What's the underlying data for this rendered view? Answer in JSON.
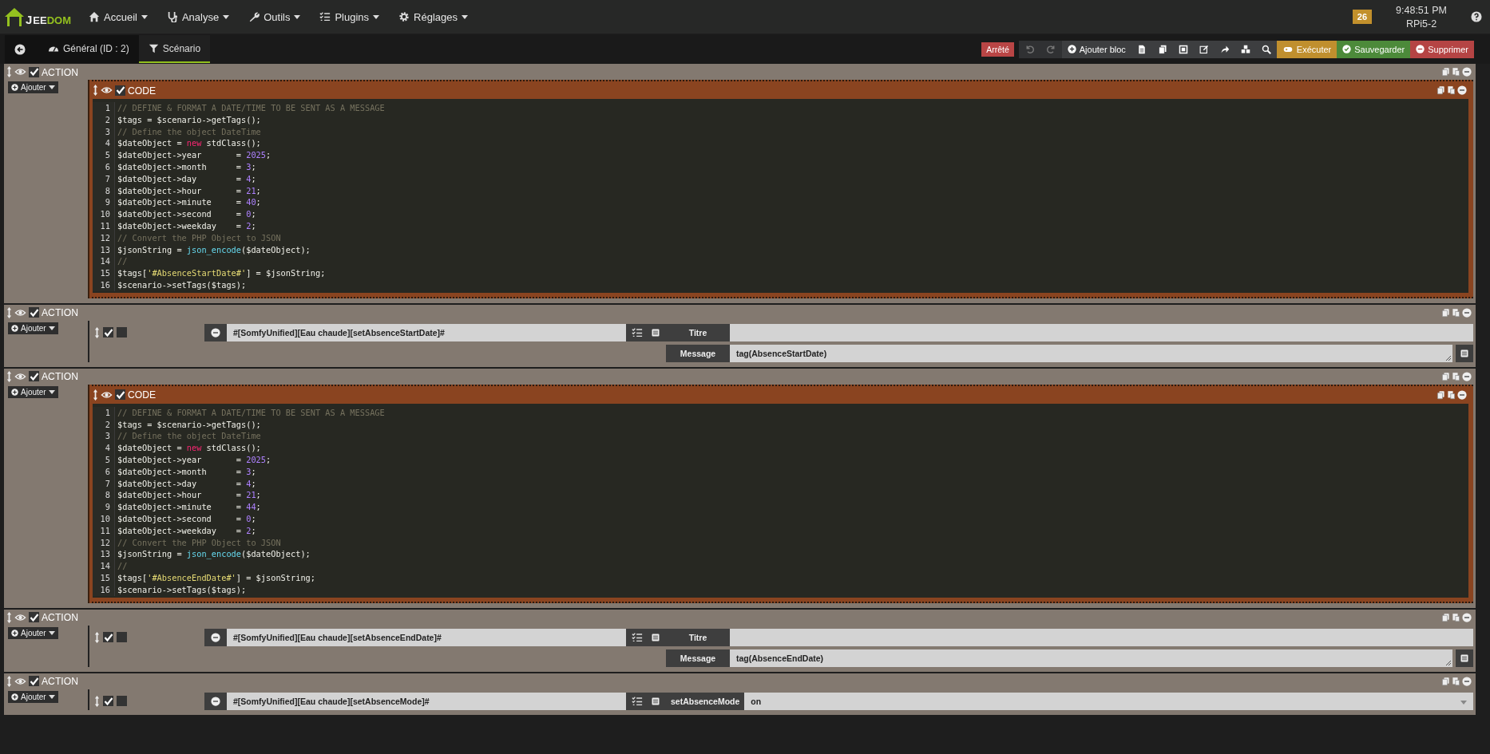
{
  "nav": {
    "logo": {
      "initial": "J",
      "middle": "EE",
      "end": "DOM"
    },
    "menu": [
      {
        "label": "Accueil"
      },
      {
        "label": "Analyse"
      },
      {
        "label": "Outils"
      },
      {
        "label": "Plugins"
      },
      {
        "label": "Réglages"
      }
    ],
    "badge": "26",
    "clock": "9:48:51 PM",
    "host": "RPi5-2"
  },
  "tabs": [
    {
      "label": "Général (ID : 2)",
      "selected": false
    },
    {
      "label": "Scénario",
      "selected": true
    }
  ],
  "toolbar": {
    "state": "Arrêté",
    "add_block": "Ajouter bloc",
    "run": "Exécuter",
    "save": "Sauvegarder",
    "delete": "Supprimer"
  },
  "blocks": [
    {
      "title": "ACTION",
      "enabled": true,
      "add_button": "Ajouter",
      "element": {
        "kind": "code",
        "title": "CODE",
        "enabled": true,
        "lines": [
          {
            "n": "1",
            "tokens": [
              {
                "kind": "comment",
                "text": "// DEFINE & FORMAT A DATE/TIME TO BE SENT AS A MESSAGE"
              }
            ]
          },
          {
            "n": "2",
            "tokens": [
              {
                "kind": "plain",
                "text": "$tags = $scenario->getTags();"
              }
            ]
          },
          {
            "n": "3",
            "tokens": [
              {
                "kind": "comment",
                "text": "// Define the object DateTime"
              }
            ]
          },
          {
            "n": "4",
            "tokens": [
              {
                "kind": "plain",
                "text": "$dateObject = "
              },
              {
                "kind": "keyword",
                "text": "new"
              },
              {
                "kind": "plain",
                "text": " stdClass();"
              }
            ]
          },
          {
            "n": "5",
            "tokens": [
              {
                "kind": "plain",
                "text": "$dateObject->year       = "
              },
              {
                "kind": "number",
                "text": "2025"
              },
              {
                "kind": "plain",
                "text": ";"
              }
            ]
          },
          {
            "n": "6",
            "tokens": [
              {
                "kind": "plain",
                "text": "$dateObject->month      = "
              },
              {
                "kind": "number",
                "text": "3"
              },
              {
                "kind": "plain",
                "text": ";"
              }
            ]
          },
          {
            "n": "7",
            "tokens": [
              {
                "kind": "plain",
                "text": "$dateObject->day        = "
              },
              {
                "kind": "number",
                "text": "4"
              },
              {
                "kind": "plain",
                "text": ";"
              }
            ]
          },
          {
            "n": "8",
            "tokens": [
              {
                "kind": "plain",
                "text": "$dateObject->hour       = "
              },
              {
                "kind": "number",
                "text": "21"
              },
              {
                "kind": "plain",
                "text": ";"
              }
            ]
          },
          {
            "n": "9",
            "tokens": [
              {
                "kind": "plain",
                "text": "$dateObject->minute     = "
              },
              {
                "kind": "number",
                "text": "40"
              },
              {
                "kind": "plain",
                "text": ";"
              }
            ]
          },
          {
            "n": "10",
            "tokens": [
              {
                "kind": "plain",
                "text": "$dateObject->second     = "
              },
              {
                "kind": "number",
                "text": "0"
              },
              {
                "kind": "plain",
                "text": ";"
              }
            ]
          },
          {
            "n": "11",
            "tokens": [
              {
                "kind": "plain",
                "text": "$dateObject->weekday    = "
              },
              {
                "kind": "number",
                "text": "2"
              },
              {
                "kind": "plain",
                "text": ";"
              }
            ]
          },
          {
            "n": "12",
            "tokens": [
              {
                "kind": "comment",
                "text": "// Convert the PHP Object to JSON"
              }
            ]
          },
          {
            "n": "13",
            "tokens": [
              {
                "kind": "plain",
                "text": "$jsonString = "
              },
              {
                "kind": "builtin",
                "text": "json_encode"
              },
              {
                "kind": "plain",
                "text": "($dateObject);"
              }
            ]
          },
          {
            "n": "14",
            "tokens": [
              {
                "kind": "comment",
                "text": "//"
              }
            ]
          },
          {
            "n": "15",
            "tokens": [
              {
                "kind": "plain",
                "text": "$tags["
              },
              {
                "kind": "string",
                "text": "'#AbsenceStartDate#'"
              },
              {
                "kind": "plain",
                "text": "] = $jsonString;"
              }
            ]
          },
          {
            "n": "16",
            "tokens": [
              {
                "kind": "plain",
                "text": "$scenario->setTags($tags);"
              }
            ]
          }
        ]
      }
    },
    {
      "title": "ACTION",
      "enabled": true,
      "add_button": "Ajouter",
      "element": {
        "kind": "action",
        "enabled": true,
        "background": false,
        "command": "#[SomfyUnified][Eau chaude][setAbsenceStartDate]#",
        "options": [
          {
            "kind": "text",
            "label": "Titre"
          },
          {
            "kind": "textarea",
            "label": "Message",
            "value": "tag(AbsenceStartDate)"
          }
        ]
      }
    },
    {
      "title": "ACTION",
      "enabled": true,
      "add_button": "Ajouter",
      "element": {
        "kind": "code",
        "title": "CODE",
        "enabled": true,
        "lines": [
          {
            "n": "1",
            "tokens": [
              {
                "kind": "comment",
                "text": "// DEFINE & FORMAT A DATE/TIME TO BE SENT AS A MESSAGE"
              }
            ]
          },
          {
            "n": "2",
            "tokens": [
              {
                "kind": "plain",
                "text": "$tags = $scenario->getTags();"
              }
            ]
          },
          {
            "n": "3",
            "tokens": [
              {
                "kind": "comment",
                "text": "// Define the object DateTime"
              }
            ]
          },
          {
            "n": "4",
            "tokens": [
              {
                "kind": "plain",
                "text": "$dateObject = "
              },
              {
                "kind": "keyword",
                "text": "new"
              },
              {
                "kind": "plain",
                "text": " stdClass();"
              }
            ]
          },
          {
            "n": "5",
            "tokens": [
              {
                "kind": "plain",
                "text": "$dateObject->year       = "
              },
              {
                "kind": "number",
                "text": "2025"
              },
              {
                "kind": "plain",
                "text": ";"
              }
            ]
          },
          {
            "n": "6",
            "tokens": [
              {
                "kind": "plain",
                "text": "$dateObject->month      = "
              },
              {
                "kind": "number",
                "text": "3"
              },
              {
                "kind": "plain",
                "text": ";"
              }
            ]
          },
          {
            "n": "7",
            "tokens": [
              {
                "kind": "plain",
                "text": "$dateObject->day        = "
              },
              {
                "kind": "number",
                "text": "4"
              },
              {
                "kind": "plain",
                "text": ";"
              }
            ]
          },
          {
            "n": "8",
            "tokens": [
              {
                "kind": "plain",
                "text": "$dateObject->hour       = "
              },
              {
                "kind": "number",
                "text": "21"
              },
              {
                "kind": "plain",
                "text": ";"
              }
            ]
          },
          {
            "n": "9",
            "tokens": [
              {
                "kind": "plain",
                "text": "$dateObject->minute     = "
              },
              {
                "kind": "number",
                "text": "44"
              },
              {
                "kind": "plain",
                "text": ";"
              }
            ]
          },
          {
            "n": "10",
            "tokens": [
              {
                "kind": "plain",
                "text": "$dateObject->second     = "
              },
              {
                "kind": "number",
                "text": "0"
              },
              {
                "kind": "plain",
                "text": ";"
              }
            ]
          },
          {
            "n": "11",
            "tokens": [
              {
                "kind": "plain",
                "text": "$dateObject->weekday    = "
              },
              {
                "kind": "number",
                "text": "2"
              },
              {
                "kind": "plain",
                "text": ";"
              }
            ]
          },
          {
            "n": "12",
            "tokens": [
              {
                "kind": "comment",
                "text": "// Convert the PHP Object to JSON"
              }
            ]
          },
          {
            "n": "13",
            "tokens": [
              {
                "kind": "plain",
                "text": "$jsonString = "
              },
              {
                "kind": "builtin",
                "text": "json_encode"
              },
              {
                "kind": "plain",
                "text": "($dateObject);"
              }
            ]
          },
          {
            "n": "14",
            "tokens": [
              {
                "kind": "comment",
                "text": "//"
              }
            ]
          },
          {
            "n": "15",
            "tokens": [
              {
                "kind": "plain",
                "text": "$tags["
              },
              {
                "kind": "string",
                "text": "'#AbsenceEndDate#'"
              },
              {
                "kind": "plain",
                "text": "] = $jsonString;"
              }
            ]
          },
          {
            "n": "16",
            "tokens": [
              {
                "kind": "plain",
                "text": "$scenario->setTags($tags);"
              }
            ]
          }
        ]
      }
    },
    {
      "title": "ACTION",
      "enabled": true,
      "add_button": "Ajouter",
      "element": {
        "kind": "action",
        "enabled": true,
        "background": false,
        "command": "#[SomfyUnified][Eau chaude][setAbsenceEndDate]#",
        "options": [
          {
            "kind": "text",
            "label": "Titre"
          },
          {
            "kind": "textarea",
            "label": "Message",
            "value": "tag(AbsenceEndDate)"
          }
        ]
      }
    },
    {
      "title": "ACTION",
      "enabled": true,
      "add_button": "Ajouter",
      "element": {
        "kind": "action",
        "enabled": true,
        "background": false,
        "command": "#[SomfyUnified][Eau chaude][setAbsenceMode]#",
        "options": [
          {
            "kind": "select",
            "label": "setAbsenceMode",
            "value": "on"
          }
        ]
      }
    }
  ]
}
